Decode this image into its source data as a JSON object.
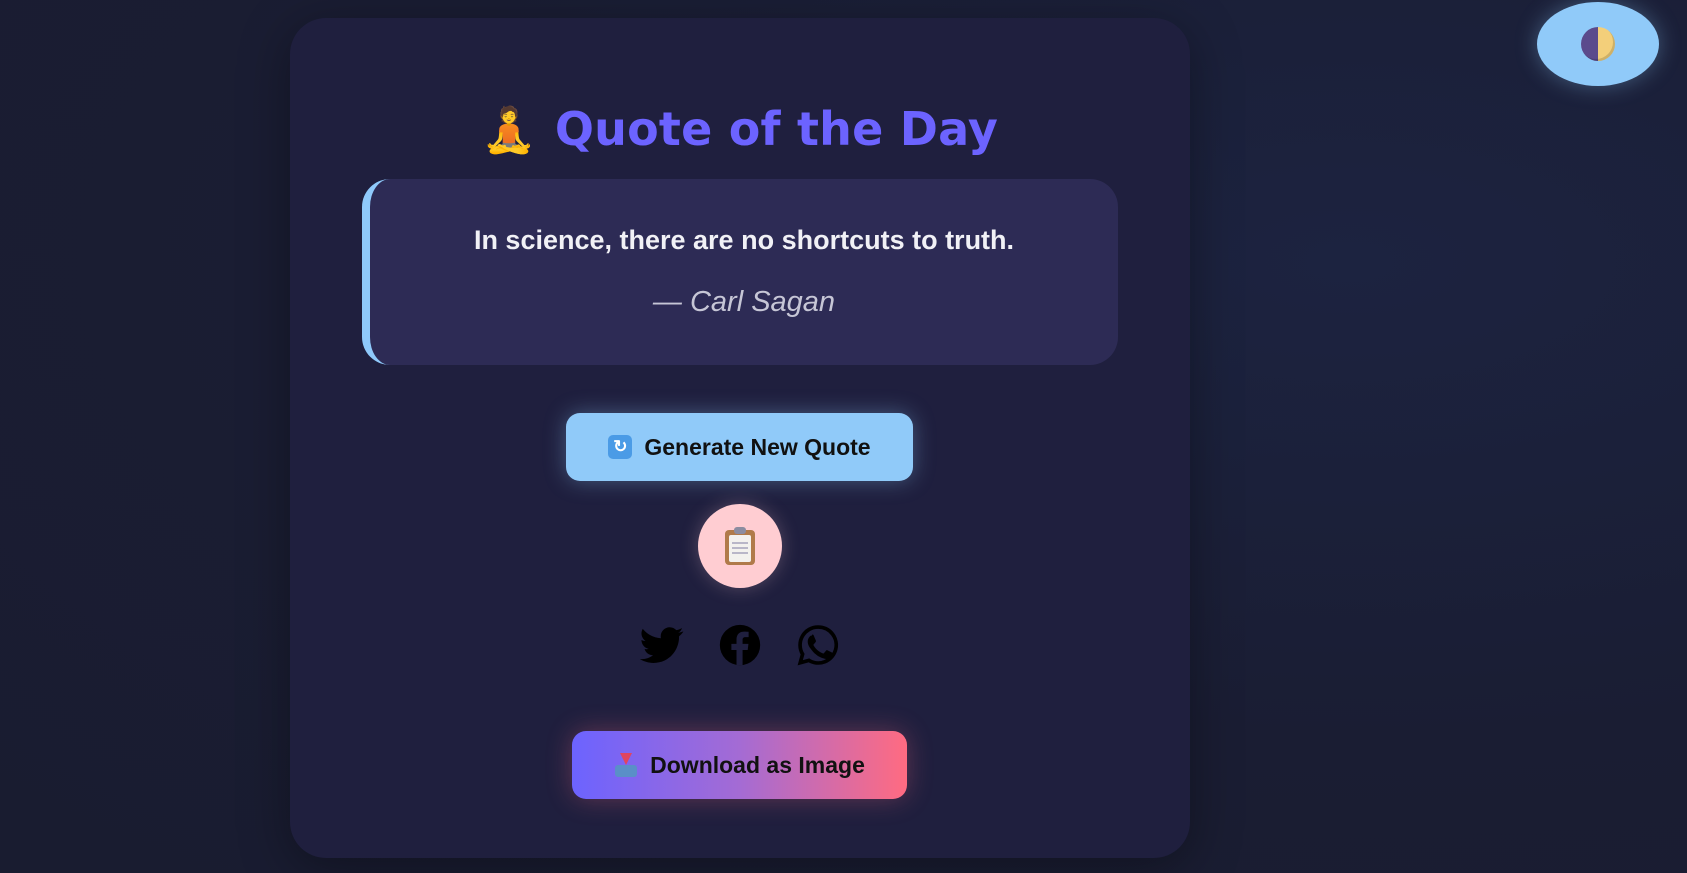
{
  "header": {
    "title": "Quote of the Day",
    "title_emoji": "🧘"
  },
  "quote": {
    "text": "In science, there are no shortcuts to truth.",
    "author": "— Carl Sagan"
  },
  "buttons": {
    "generate_label": "Generate New Quote",
    "generate_icon": "refresh-icon",
    "copy_icon": "clipboard-icon",
    "download_label": "Download as Image",
    "download_icon": "inbox-tray-icon",
    "theme_toggle_icon": "half-moon-icon"
  },
  "social": [
    "twitter-icon",
    "facebook-icon",
    "whatsapp-icon"
  ],
  "colors": {
    "accent": "#6c63ff",
    "light_blue": "#90caf9",
    "pink": "#ffcdd2",
    "gradient_end": "#ff6b81",
    "card_bg": "#1f1f3e",
    "quote_bg": "#2d2b55"
  }
}
